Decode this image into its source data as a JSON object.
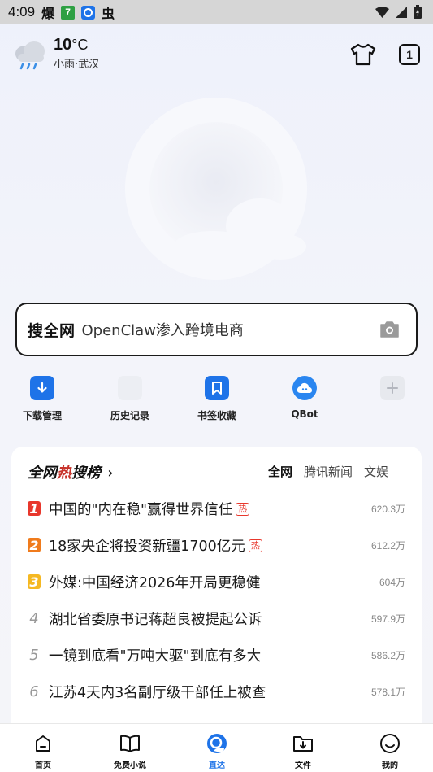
{
  "status_bar": {
    "time": "4:09",
    "left_icons": [
      "爆",
      "7",
      "browser-icon",
      "虫"
    ]
  },
  "weather": {
    "temperature": "10",
    "unit": "°C",
    "description": "小雨·武汉"
  },
  "header": {
    "tab_count": "1"
  },
  "search": {
    "brand": "搜全网",
    "query": "OpenClaw渗入跨境电商"
  },
  "shortcuts": [
    {
      "label": "下载管理"
    },
    {
      "label": "历史记录"
    },
    {
      "label": "书签收藏"
    },
    {
      "label": "QBot"
    }
  ],
  "hot_board": {
    "title_prefix": "全网",
    "title_hot": "热",
    "title_suffix": "搜榜",
    "arrow": "›",
    "tabs": [
      "全网",
      "腾讯新闻",
      "文娱"
    ],
    "items": [
      {
        "rank": "1",
        "title": "中国的\"内在稳\"赢得世界信任",
        "badge": "热",
        "count": "620.3万"
      },
      {
        "rank": "2",
        "title": "18家央企将投资新疆1700亿元",
        "badge": "热",
        "count": "612.2万"
      },
      {
        "rank": "3",
        "title": "外媒:中国经济2026年开局更稳健",
        "badge": "",
        "count": "604万"
      },
      {
        "rank": "4",
        "title": "湖北省委原书记蒋超良被提起公诉",
        "badge": "",
        "count": "597.9万"
      },
      {
        "rank": "5",
        "title": "一镜到底看\"万吨大驱\"到底有多大",
        "badge": "",
        "count": "586.2万"
      },
      {
        "rank": "6",
        "title": "江苏4天内3名副厅级干部任上被查",
        "badge": "",
        "count": "578.1万"
      }
    ]
  },
  "bottom_nav": [
    {
      "label": "首页"
    },
    {
      "label": "免费小说"
    },
    {
      "label": "直达"
    },
    {
      "label": "文件"
    },
    {
      "label": "我的"
    }
  ],
  "colors": {
    "accent": "#1e73e8",
    "rank1": "#e8372c",
    "rank2": "#f07b1c",
    "rank3": "#f5b822"
  }
}
